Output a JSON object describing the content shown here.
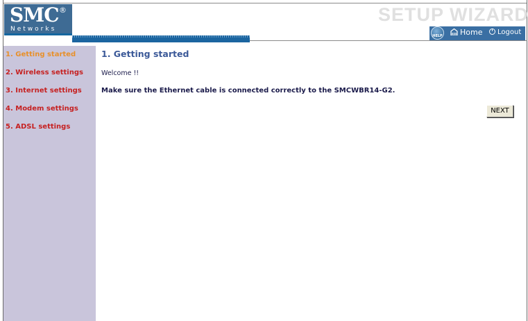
{
  "header": {
    "logo_text": "SMC",
    "logo_reg": "®",
    "logo_sub": "Networks",
    "title": "SETUP WIZARD",
    "help_label": "HELP",
    "home_label": "Home",
    "logout_label": "Logout"
  },
  "sidebar": {
    "items": [
      {
        "label": "1. Getting started",
        "active": true
      },
      {
        "label": "2. Wireless settings",
        "active": false
      },
      {
        "label": "3. Internet settings",
        "active": false
      },
      {
        "label": "4. Modem settings",
        "active": false
      },
      {
        "label": "5. ADSL settings",
        "active": false
      }
    ]
  },
  "main": {
    "title": "1. Getting started",
    "welcome": "Welcome !!",
    "instruction": "Make sure the Ethernet cable is connected correctly to the SMCWBR14-G2.",
    "next_label": "NEXT"
  },
  "colors": {
    "logo_bg": "#3e6b94",
    "sidebar_bg": "#c9c5db",
    "active_item": "#e8902a",
    "inactive_item": "#c62121",
    "title_blue": "#3b5998"
  },
  "icons": {
    "help": "help-icon",
    "home": "home-icon",
    "logout": "logout-icon"
  }
}
